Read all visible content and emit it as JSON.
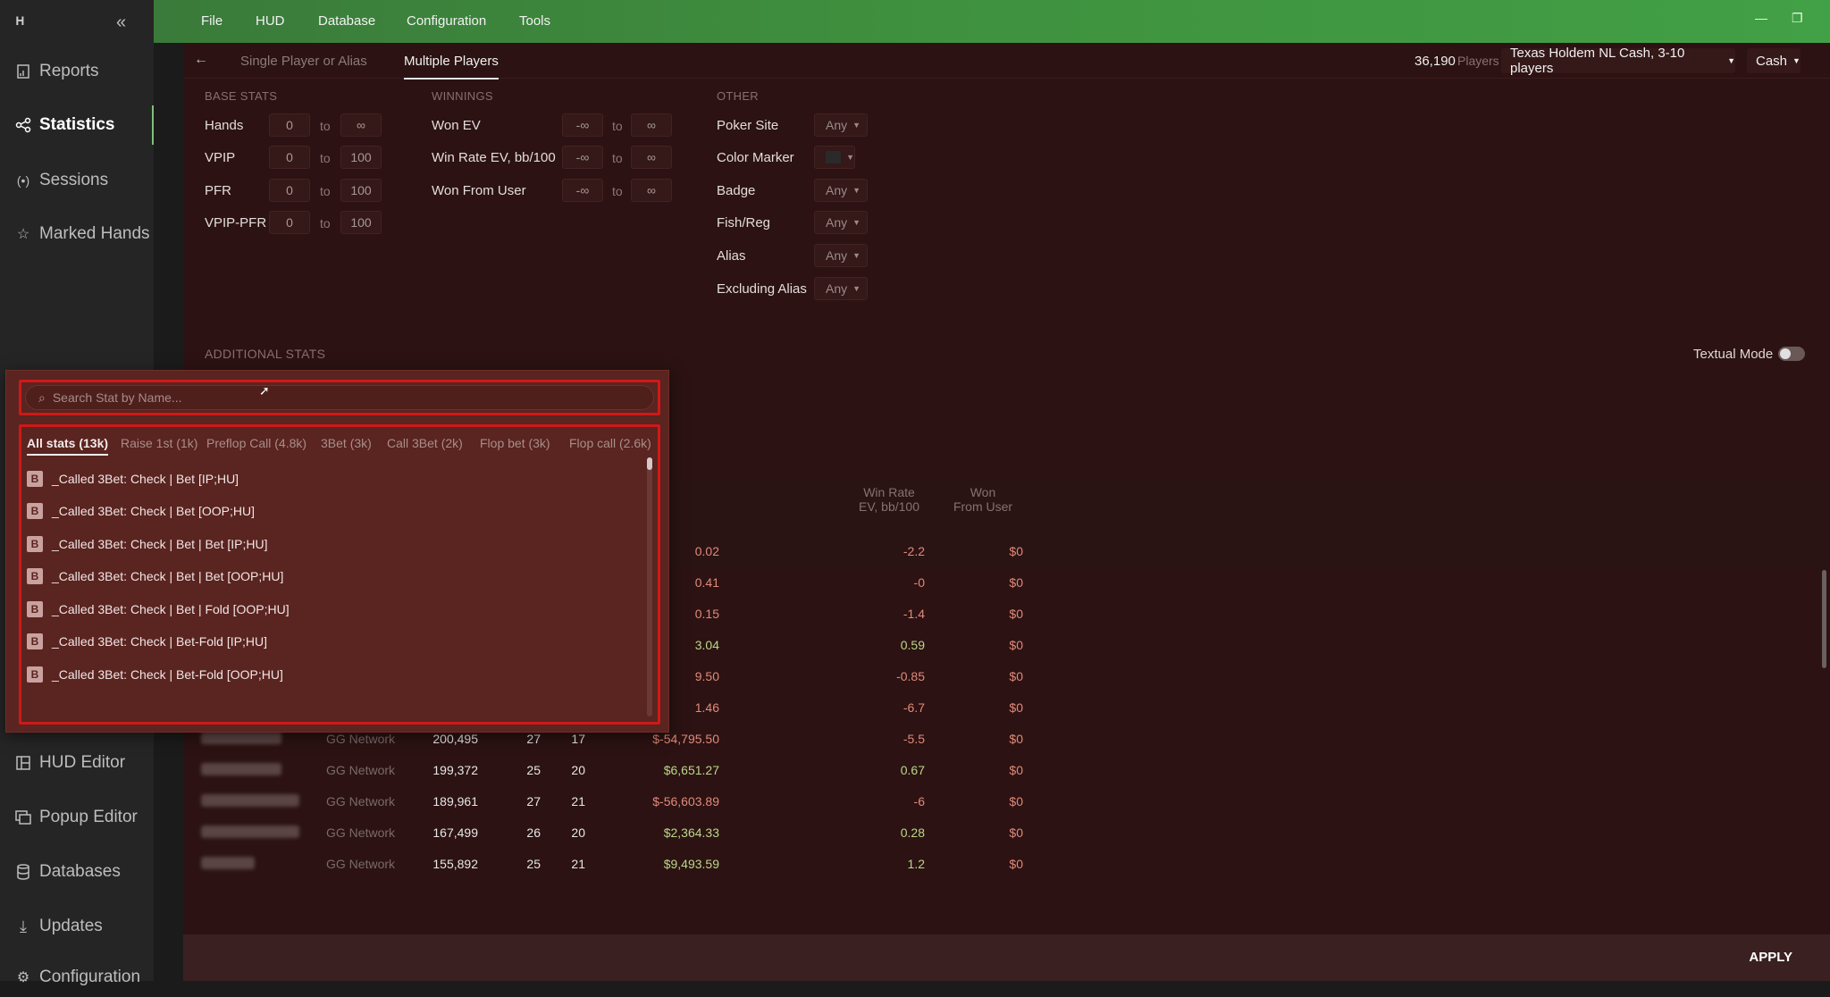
{
  "sidebar": {
    "collapse_icon": "double-chevron-left-icon",
    "items": [
      {
        "label": "Reports",
        "icon": "report-icon"
      },
      {
        "label": "Statistics",
        "icon": "share-nodes-icon",
        "active": true
      },
      {
        "label": "Sessions",
        "icon": "broadcast-icon"
      },
      {
        "label": "Marked Hands",
        "icon": "star-list-icon"
      },
      {
        "label": "HUD Editor",
        "icon": "layout-icon"
      },
      {
        "label": "Popup Editor",
        "icon": "windows-icon"
      },
      {
        "label": "Databases",
        "icon": "database-icon"
      },
      {
        "label": "Updates",
        "icon": "download-icon"
      },
      {
        "label": "Configuration",
        "icon": "gear-icon"
      }
    ]
  },
  "menu": [
    "File",
    "HUD",
    "Database",
    "Configuration",
    "Tools"
  ],
  "tabs": {
    "single": "Single Player or Alias",
    "multiple": "Multiple Players",
    "player_count": "36,190",
    "players_word": "Players",
    "game_type": "Texas Holdem NL Cash, 3-10 players",
    "mode": "Cash"
  },
  "base_stats": {
    "title": "BASE STATS",
    "rows": [
      {
        "label": "Hands",
        "from": "0",
        "to": "∞"
      },
      {
        "label": "VPIP",
        "from": "0",
        "to": "100"
      },
      {
        "label": "PFR",
        "from": "0",
        "to": "100"
      },
      {
        "label": "VPIP-PFR",
        "from": "0",
        "to": "100"
      }
    ]
  },
  "winnings": {
    "title": "WINNINGS",
    "rows": [
      {
        "label": "Won EV",
        "from": "-∞",
        "to": "∞"
      },
      {
        "label": "Win Rate EV, bb/100",
        "from": "-∞",
        "to": "∞"
      },
      {
        "label": "Won From User",
        "from": "-∞",
        "to": "∞"
      }
    ]
  },
  "to_word": "to",
  "other": {
    "title": "OTHER",
    "rows": [
      {
        "label": "Poker Site",
        "value": "Any"
      },
      {
        "label": "Color Marker",
        "value": ""
      },
      {
        "label": "Badge",
        "value": "Any"
      },
      {
        "label": "Fish/Reg",
        "value": "Any"
      },
      {
        "label": "Alias",
        "value": "Any"
      },
      {
        "label": "Excluding Alias",
        "value": "Any"
      }
    ]
  },
  "additional_stats": "ADDITIONAL STATS",
  "textual_mode": "Textual Mode",
  "table": {
    "headers": {
      "winrate": "Win Rate\nEV, bb/100",
      "wonfrom": "Won\nFrom User"
    },
    "top_rows": [
      {
        "ev": "0.02",
        "wr": "-2.2",
        "wfu": "$0"
      },
      {
        "ev": "0.41",
        "wr": "-0",
        "wfu": "$0"
      },
      {
        "ev": "0.15",
        "wr": "-1.4",
        "wfu": "$0"
      },
      {
        "ev": "3.04",
        "wr": "0.59",
        "wfu": "$0"
      },
      {
        "ev": "9.50",
        "wr": "-0.85",
        "wfu": "$0"
      },
      {
        "ev": "1.46",
        "wr": "-6.7",
        "wfu": "$0"
      }
    ],
    "rows": [
      {
        "site": "GG Network",
        "hands": "200,495",
        "vpip": "27",
        "pfr": "17",
        "ev": "$-54,795.50",
        "wr": "-5.5",
        "wfu": "$0"
      },
      {
        "site": "GG Network",
        "hands": "199,372",
        "vpip": "25",
        "pfr": "20",
        "ev": "$6,651.27",
        "wr": "0.67",
        "wfu": "$0"
      },
      {
        "site": "GG Network",
        "hands": "189,961",
        "vpip": "27",
        "pfr": "21",
        "ev": "$-56,603.89",
        "wr": "-6",
        "wfu": "$0"
      },
      {
        "site": "GG Network",
        "hands": "167,499",
        "vpip": "26",
        "pfr": "20",
        "ev": "$2,364.33",
        "wr": "0.28",
        "wfu": "$0"
      },
      {
        "site": "GG Network",
        "hands": "155,892",
        "vpip": "25",
        "pfr": "21",
        "ev": "$9,493.59",
        "wr": "1.2",
        "wfu": "$0"
      }
    ]
  },
  "popup": {
    "search_placeholder": "Search Stat by Name...",
    "tabs": [
      "All stats (13k)",
      "Raise 1st (1k)",
      "Preflop Call (4.8k)",
      "3Bet (3k)",
      "Call 3Bet (2k)",
      "Flop bet (3k)",
      "Flop call (2.6k)"
    ],
    "badge": "B",
    "items": [
      "_Called 3Bet: Check | Bet [IP;HU]",
      "_Called 3Bet: Check | Bet [OOP;HU]",
      "_Called 3Bet: Check | Bet | Bet [IP;HU]",
      "_Called 3Bet: Check | Bet | Bet [OOP;HU]",
      "_Called 3Bet: Check | Bet | Fold [OOP;HU]",
      "_Called 3Bet: Check | Bet-Fold [IP;HU]",
      "_Called 3Bet: Check | Bet-Fold [OOP;HU]"
    ]
  },
  "apply": "APPLY",
  "colors": {
    "accent": "#42a046",
    "panel": "#2c1212",
    "popup": "#5a2420",
    "highlight": "#d01818"
  }
}
